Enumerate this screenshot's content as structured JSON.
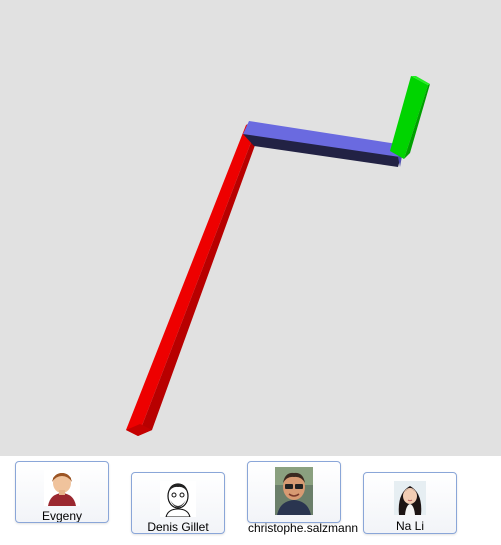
{
  "scene": {
    "background": "#e1e1e1",
    "segments": [
      {
        "name": "red-segment",
        "color": "#ee0000"
      },
      {
        "name": "blue-segment",
        "color": "#6666dd"
      },
      {
        "name": "green-segment",
        "color": "#00dd00"
      }
    ]
  },
  "participants": [
    {
      "name": "Evgeny",
      "avatar": "evgeny-avatar-icon"
    },
    {
      "name": "Denis Gillet",
      "avatar": "denis-gillet-avatar-icon"
    },
    {
      "name": "christophe.salzmann",
      "avatar": "christophe-avatar-icon"
    },
    {
      "name": "Na Li",
      "avatar": "na-li-avatar-icon"
    }
  ]
}
